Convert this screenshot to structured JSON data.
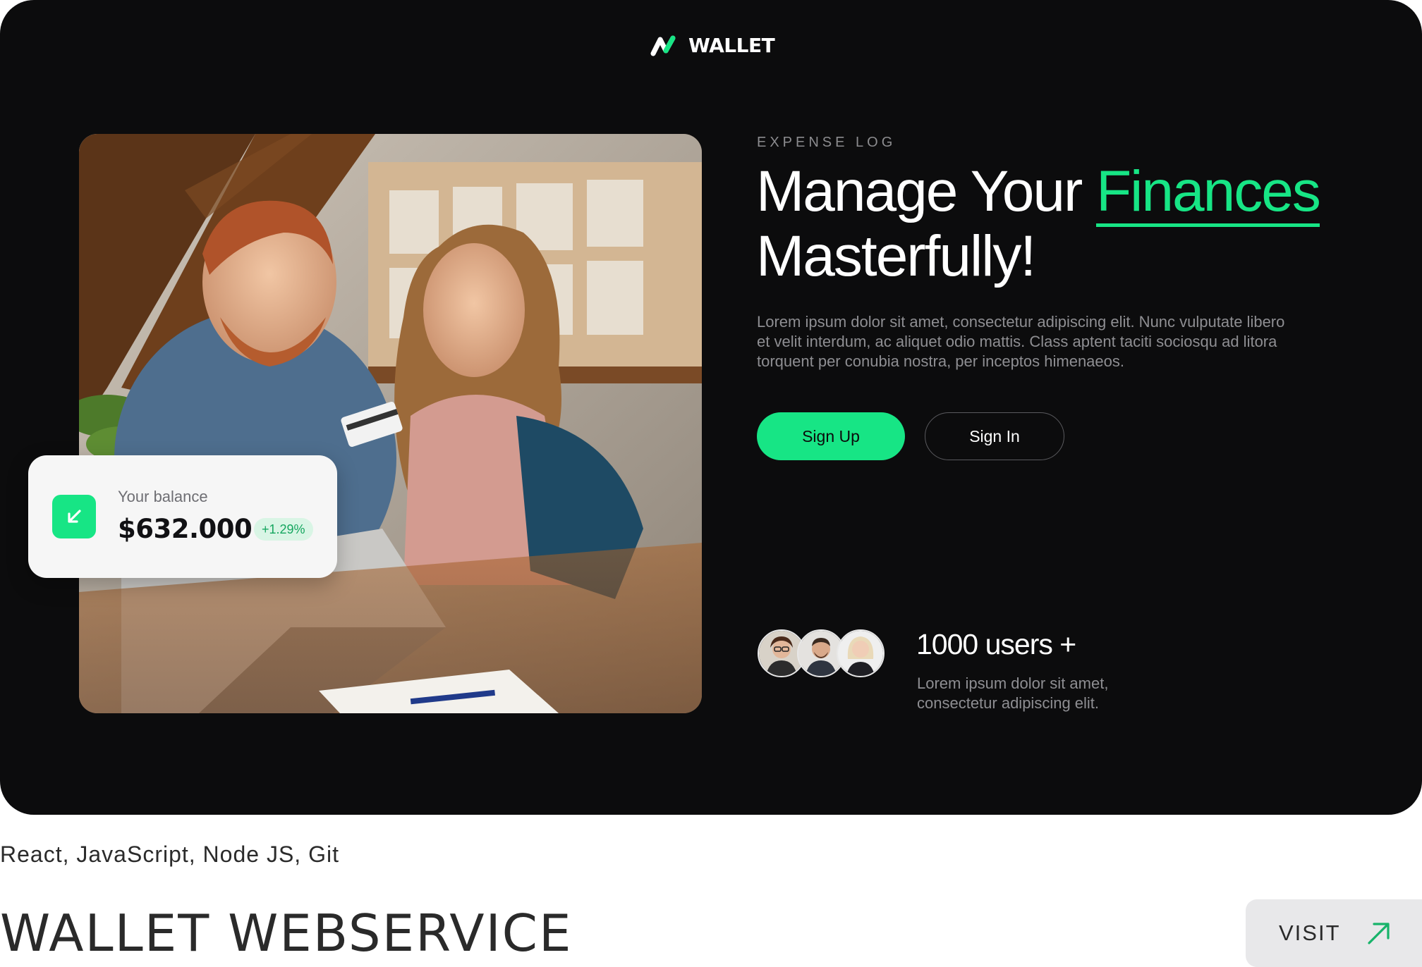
{
  "brand": {
    "name": "WALLET",
    "accent_color": "#17e585",
    "background_color": "#0c0c0d"
  },
  "hero": {
    "eyebrow": "EXPENSE LOG",
    "headline_part1": "Manage Your ",
    "headline_accent": "Finances",
    "headline_part2": "Masterfully!",
    "description": "Lorem ipsum dolor sit amet, consectetur adipiscing elit. Nunc vulputate libero et velit interdum, ac aliquet odio mattis. Class aptent taciti sociosqu ad litora torquent per conubia nostra, per inceptos himenaeos.",
    "signup_label": "Sign Up",
    "signin_label": "Sign In"
  },
  "balance_card": {
    "label": "Your balance",
    "amount": "$632.000",
    "change": "+1.29%",
    "icon": "arrow-down-left-icon"
  },
  "users": {
    "count": "1000 users +",
    "description": "Lorem ipsum dolor sit amet, consectetur adipiscing elit."
  },
  "project": {
    "tech_stack": "React, JavaScript, Node JS, Git",
    "title": "WALLET WEBSERVICE",
    "visit_label": "VISIT",
    "visit_icon": "arrow-up-right-icon"
  }
}
